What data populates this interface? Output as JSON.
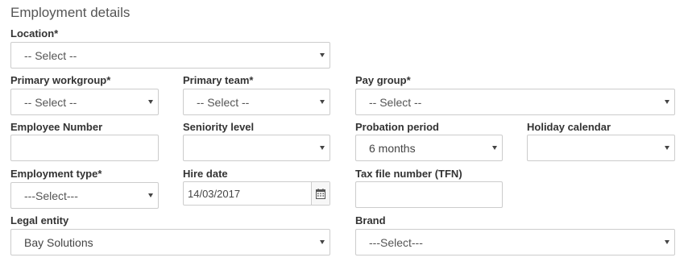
{
  "section_title": "Employment details",
  "fields": {
    "location": {
      "label": "Location*",
      "value": "-- Select --"
    },
    "primary_workgroup": {
      "label": "Primary workgroup*",
      "value": "-- Select --"
    },
    "primary_team": {
      "label": "Primary team*",
      "value": "-- Select --"
    },
    "pay_group": {
      "label": "Pay group*",
      "value": "-- Select --"
    },
    "employee_number": {
      "label": "Employee Number",
      "value": ""
    },
    "seniority_level": {
      "label": "Seniority level",
      "value": ""
    },
    "probation_period": {
      "label": "Probation period",
      "value": "6 months"
    },
    "holiday_calendar": {
      "label": "Holiday calendar",
      "value": ""
    },
    "employment_type": {
      "label": "Employment type*",
      "value": "---Select---"
    },
    "hire_date": {
      "label": "Hire date",
      "value": "14/03/2017"
    },
    "tfn": {
      "label": "Tax file number (TFN)",
      "value": ""
    },
    "legal_entity": {
      "label": "Legal entity",
      "value": "Bay Solutions"
    },
    "brand": {
      "label": "Brand",
      "value": "---Select---"
    }
  },
  "icons": {
    "dropdown": "chevron-down-icon",
    "calendar": "calendar-icon"
  }
}
